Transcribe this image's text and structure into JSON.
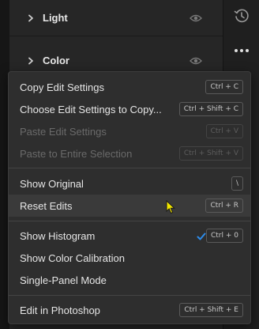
{
  "panel": {
    "sections": [
      {
        "title": "Light",
        "icon": "eye-icon"
      },
      {
        "title": "Color",
        "icon": "eye-icon"
      }
    ]
  },
  "toolstrip": {
    "icons": [
      "history-icon",
      "more-options-icon"
    ]
  },
  "menu": {
    "items": [
      {
        "label": "Copy Edit Settings",
        "shortcut": "Ctrl + C",
        "enabled": true
      },
      {
        "label": "Choose Edit Settings to Copy...",
        "shortcut": "Ctrl + Shift + C",
        "enabled": true
      },
      {
        "label": "Paste Edit Settings",
        "shortcut": "Ctrl + V",
        "enabled": false
      },
      {
        "label": "Paste to Entire Selection",
        "shortcut": "Ctrl + Shift + V",
        "enabled": false
      },
      {
        "label": "Show Original",
        "shortcut": "\\",
        "enabled": true
      },
      {
        "label": "Reset Edits",
        "shortcut": "Ctrl + R",
        "enabled": true,
        "hovered": true
      },
      {
        "label": "Show Histogram",
        "shortcut": "Ctrl + 0",
        "enabled": true,
        "checked": true
      },
      {
        "label": "Show Color Calibration",
        "shortcut": "",
        "enabled": true
      },
      {
        "label": "Single-Panel Mode",
        "shortcut": "",
        "enabled": true
      },
      {
        "label": "Edit in Photoshop",
        "shortcut": "Ctrl + Shift + E",
        "enabled": true
      }
    ]
  },
  "colors": {
    "check": "#2d8ceb",
    "cursor": "#f2e600"
  }
}
